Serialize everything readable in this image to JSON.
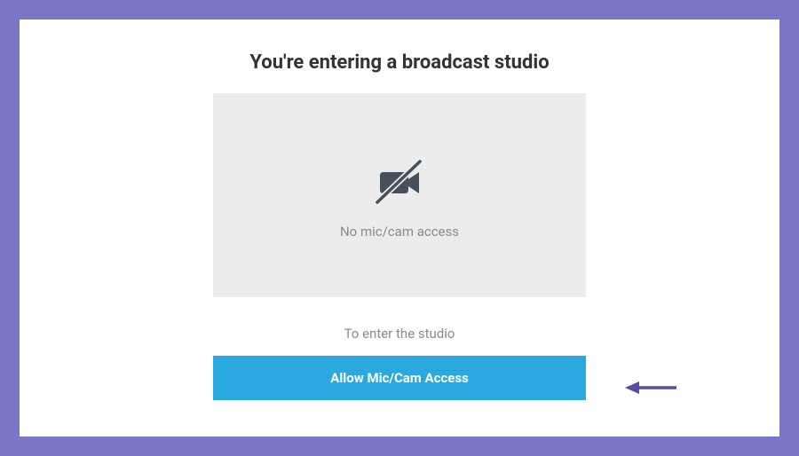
{
  "colors": {
    "frame": "#7a77c7",
    "modal_bg": "#ffffff",
    "preview_bg": "#ececec",
    "button_bg": "#29a9e0",
    "button_text": "#ffffff",
    "title_text": "#333333",
    "muted_text": "#8a8a8a",
    "icon_fill": "#45505a",
    "arrow_fill": "#5d4ba8"
  },
  "modal": {
    "title": "You're entering a broadcast studio",
    "preview": {
      "status_text": "No mic/cam access",
      "icon": "camera-off-icon"
    },
    "instruction": "To enter the studio",
    "cta_label": "Allow Mic/Cam Access"
  },
  "annotation": {
    "arrow_points_to": "allow-mic-cam-button"
  }
}
